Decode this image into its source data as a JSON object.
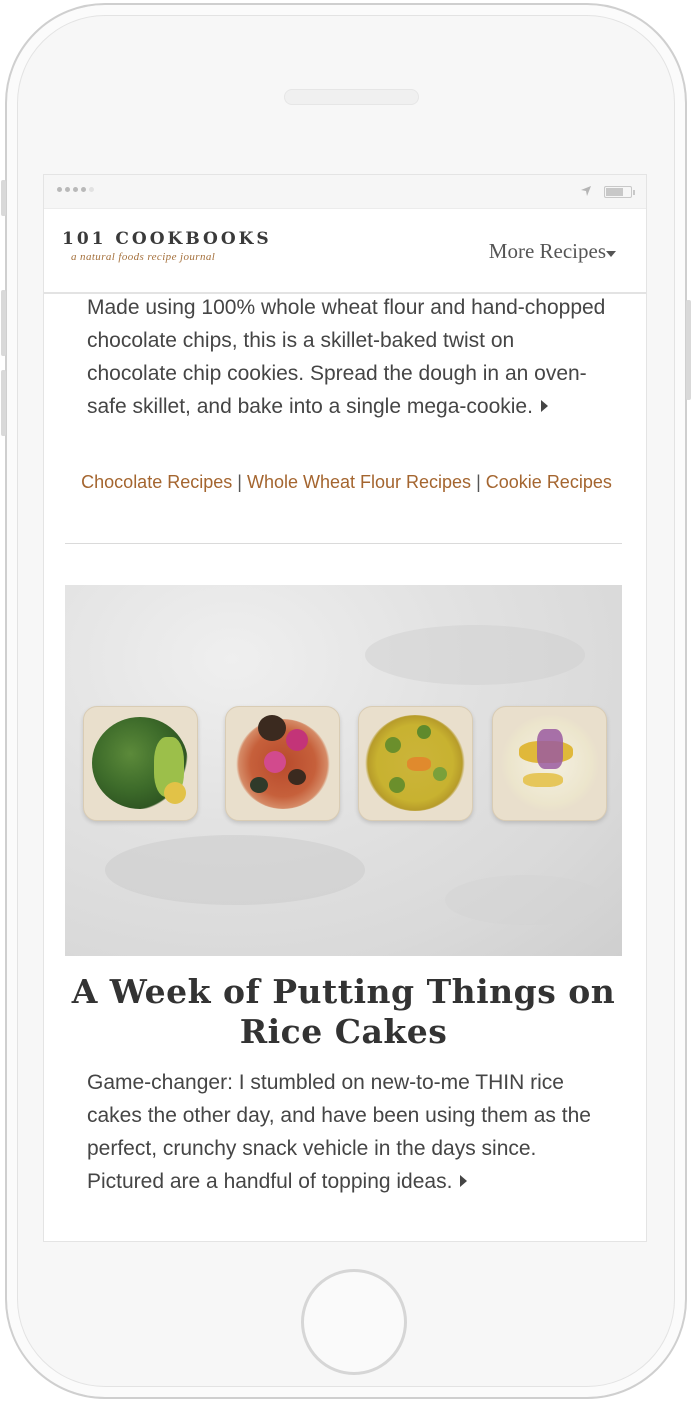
{
  "header": {
    "logo_title": "101 Cookbooks",
    "logo_tagline": "a natural foods recipe journal",
    "nav_label": "More Recipes"
  },
  "post1": {
    "excerpt": "Made using 100% whole wheat flour and hand-chopped chocolate chips, this is a skillet-baked twist on chocolate chip cookies. Spread the dough in an oven-safe skillet, and bake into a single mega-cookie.",
    "tags": [
      "Chocolate Recipes",
      "Whole Wheat Flour Recipes",
      "Cookie Recipes"
    ],
    "separator": "|"
  },
  "post2": {
    "image_alt": "rice cakes with toppings",
    "title": "A Week of Putting Things on Rice Cakes",
    "excerpt": "Game-changer: I stumbled on new-to-me THIN rice cakes the other day, and have been using them as the perfect, crunchy snack vehicle in the days since. Pictured are a handful of topping ideas."
  },
  "icons": {
    "nav": "chevron-down-icon",
    "read_more": "caret-right-icon",
    "status_location": "location-arrow-icon",
    "status_battery": "battery-icon"
  },
  "colors": {
    "link": "#a4652f",
    "tagline": "#a5713d",
    "text": "#454545"
  }
}
